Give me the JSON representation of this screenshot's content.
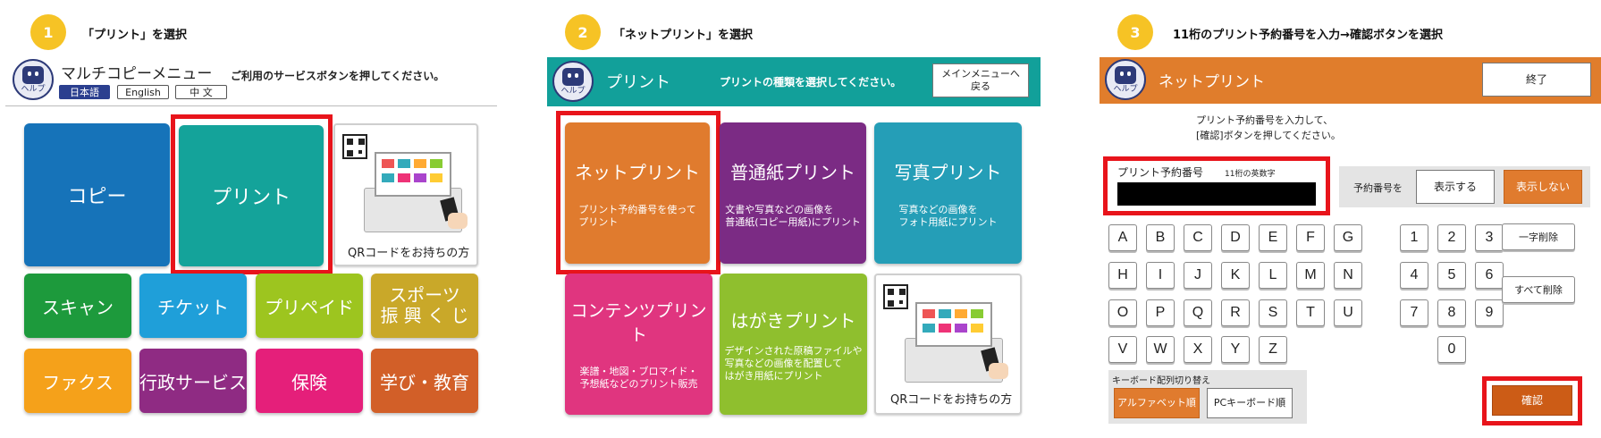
{
  "colors": {
    "step_circle": "#f6c325",
    "highlight_red": "#e8141b",
    "copy": "#1673b9",
    "print": "#14a39a",
    "scan": "#1d9a3c",
    "ticket": "#1f9fd9",
    "prepaid": "#9dc51f",
    "sports": "#c9a829",
    "fax": "#f5a11a",
    "gov": "#8f2b83",
    "insurance": "#e51f7a",
    "edu": "#d25f28",
    "netprint": "#e07b2e",
    "plain": "#7b2b84",
    "photo": "#259eb7",
    "contents": "#e0357f",
    "postcard": "#8fbf2e",
    "teal_header": "#12a09a",
    "orange_header": "#e07d2c"
  },
  "step1": {
    "number": "1",
    "instruction": "「プリント」を選択",
    "help_label": "ヘルプ",
    "menu_title": "マルチコピーメニュー",
    "menu_prompt": "ご利用のサービスボタンを押してください。",
    "languages": [
      "日本語",
      "English",
      "中 文"
    ],
    "tiles": {
      "copy": "コピー",
      "print": "プリント",
      "qr": "QRコードをお持ちの方",
      "scan": "スキャン",
      "ticket": "チケット",
      "prepaid": "プリペイド",
      "sports_line1": "スポーツ",
      "sports_line2": "振 興 く じ",
      "fax": "ファクス",
      "gov": "行政サービス",
      "insurance": "保険",
      "edu": "学び・教育"
    }
  },
  "step2": {
    "number": "2",
    "instruction": "「ネットプリント」を選択",
    "help_label": "ヘルプ",
    "header_title": "プリント",
    "header_prompt": "プリントの種類を選択してください。",
    "back_button": "メインメニューへ\n戻る",
    "tiles": {
      "netprint_title": "ネットプリント",
      "netprint_sub": "プリント予約番号を使って\nプリント",
      "plain_title": "普通紙プリント",
      "plain_sub": "文書や写真などの画像を\n普通紙(コピー用紙)にプリント",
      "photo_title": "写真プリント",
      "photo_sub": "写真などの画像を\nフォト用紙にプリント",
      "contents_title": "コンテンツプリント",
      "contents_sub": "楽譜・地図・ブロマイド・\n予想紙などのプリント販売",
      "postcard_title": "はがきプリント",
      "postcard_sub": "デザインされた原稿ファイルや\n写真などの画像を配置して\nはがき用紙にプリント",
      "qr": "QRコードをお持ちの方"
    }
  },
  "step3": {
    "number": "3",
    "instruction": "11桁のプリント予約番号を入力→確認ボタンを選択",
    "help_label": "ヘルプ",
    "header_title": "ネットプリント",
    "end_button": "終了",
    "prompt": "プリント予約番号を入力して、\n[確認]ボタンを押してください。",
    "field_label": "プリント予約番号",
    "field_hint": "11桁の英数字",
    "field_value": "",
    "display_label": "予約番号を",
    "show_button": "表示する",
    "hide_button": "表示しない",
    "letter_rows": [
      [
        "A",
        "B",
        "C",
        "D",
        "E",
        "F",
        "G"
      ],
      [
        "H",
        "I",
        "J",
        "K",
        "L",
        "M",
        "N"
      ],
      [
        "O",
        "P",
        "Q",
        "R",
        "S",
        "T",
        "U"
      ],
      [
        "V",
        "W",
        "X",
        "Y",
        "Z"
      ]
    ],
    "digit_rows": [
      [
        "1",
        "2",
        "3"
      ],
      [
        "4",
        "5",
        "6"
      ],
      [
        "7",
        "8",
        "9"
      ],
      [
        "0"
      ]
    ],
    "delete_one": "一字削除",
    "delete_all": "すべて削除",
    "layout_label": "キーボード配列切り替え",
    "alphabet_order": "アルファベット順",
    "pc_order": "PCキーボード順",
    "confirm_button": "確認"
  }
}
